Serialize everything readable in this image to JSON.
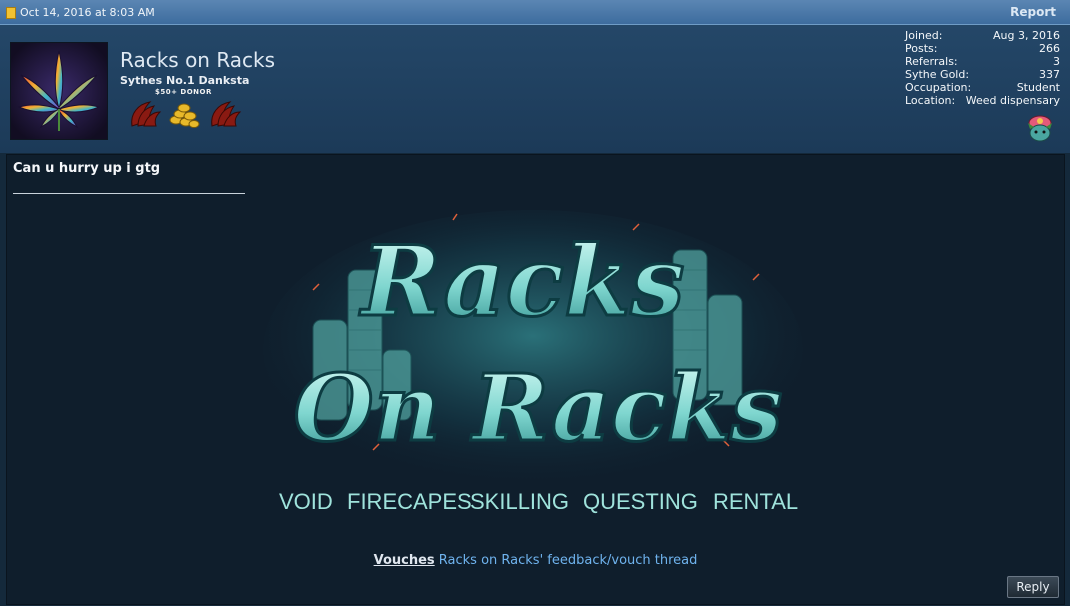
{
  "post": {
    "date": "Oct 14, 2016 at 8:03 AM",
    "report_label": "Report",
    "message": "Can u hurry up i gtg",
    "reply_label": "Reply"
  },
  "user": {
    "name": "Racks on Racks",
    "title": "Sythes No.1 Danksta",
    "donor_badge": "$50+ DONOR",
    "stats": [
      {
        "label": "Joined:",
        "value": "Aug 3, 2016"
      },
      {
        "label": "Posts:",
        "value": "266"
      },
      {
        "label": "Referrals:",
        "value": "3"
      },
      {
        "label": "Sythe Gold:",
        "value": "337"
      },
      {
        "label": "Occupation:",
        "value": "Student"
      },
      {
        "label": "Location:",
        "value": "Weed dispensary"
      }
    ]
  },
  "signature": {
    "banner_line1": "Racks",
    "banner_line2": "On Racks",
    "services": [
      "VOID",
      "FIRECAPES",
      "SKILLING",
      "QUESTING",
      "RENTAL"
    ],
    "vouches_label": "Vouches",
    "vouch_link": "Racks on Racks' feedback/vouch thread"
  },
  "colors": {
    "header_bar": "#4a77a6",
    "userinfo_bg": "#214466",
    "message_bg": "#0f1e2c",
    "link": "#6fb3ee",
    "banner_teal": "#9fe3dc"
  }
}
